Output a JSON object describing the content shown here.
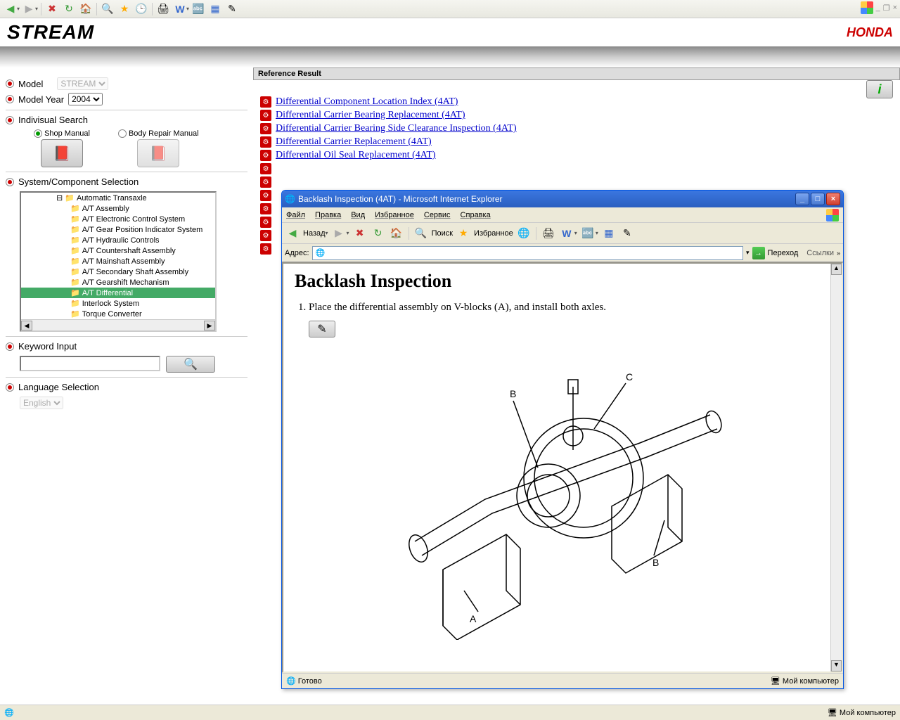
{
  "os_controls": {
    "minimize": "_",
    "restore": "❐",
    "close": "×"
  },
  "toolbar_main": {
    "back_label": "",
    "stop": "✖",
    "refresh": "↻",
    "home": "🏠",
    "search": "🔍",
    "fav": "★",
    "history": "🕒",
    "print": "🖨",
    "word": "W",
    "edit": "✎",
    "grid": "▦"
  },
  "brand": {
    "stream": "STREAM",
    "honda": "HONDA"
  },
  "sidebar": {
    "model_label": "Model",
    "model_value": "STREAM",
    "year_label": "Model Year",
    "year_value": "2004",
    "indivisual": "Indivisual Search",
    "shop_manual": "Shop Manual",
    "body_repair": "Body Repair Manual",
    "system_sel": "System/Component Selection",
    "keyword": "Keyword Input",
    "language": "Language Selection",
    "language_value": "English",
    "tree": [
      {
        "label": "Automatic Transaxle",
        "level": 1,
        "open": true
      },
      {
        "label": "A/T Assembly",
        "level": 2
      },
      {
        "label": "A/T Electronic Control System",
        "level": 2
      },
      {
        "label": "A/T Gear Position Indicator System",
        "level": 2
      },
      {
        "label": "A/T Hydraulic Controls",
        "level": 2
      },
      {
        "label": "A/T Countershaft Assembly",
        "level": 2
      },
      {
        "label": "A/T Mainshaft Assembly",
        "level": 2
      },
      {
        "label": "A/T Secondary Shaft Assembly",
        "level": 2
      },
      {
        "label": "A/T Gearshift Mechanism",
        "level": 2
      },
      {
        "label": "A/T Differential",
        "level": 2,
        "sel": true
      },
      {
        "label": "Interlock System",
        "level": 2
      },
      {
        "label": "Torque Converter",
        "level": 2
      }
    ]
  },
  "content": {
    "ref_header": "Reference Result",
    "links": [
      "Differential Component Location Index (4AT)",
      "Differential Carrier Bearing Replacement (4AT)",
      "Differential Carrier Bearing Side Clearance Inspection (4AT)",
      "Differential Carrier Replacement (4AT)",
      "Differential Oil Seal Replacement (4AT)"
    ]
  },
  "popup": {
    "title": "Backlash Inspection (4AT) - Microsoft Internet Explorer",
    "menu": [
      "Файл",
      "Правка",
      "Вид",
      "Избранное",
      "Сервис",
      "Справка"
    ],
    "tb_back": "Назад",
    "tb_search": "Поиск",
    "tb_fav": "Избранное",
    "addr_label": "Адрес:",
    "go_label": "Переход",
    "links_label": "Ссылки",
    "heading": "Backlash Inspection",
    "step1": "Place the differential assembly on V-blocks (A), and install both axles.",
    "labels": {
      "A": "A",
      "B": "B",
      "C": "C"
    },
    "status_ready": "Готово",
    "status_zone": "Мой компьютер"
  },
  "statusbar": {
    "zone": "Мой компьютер"
  }
}
